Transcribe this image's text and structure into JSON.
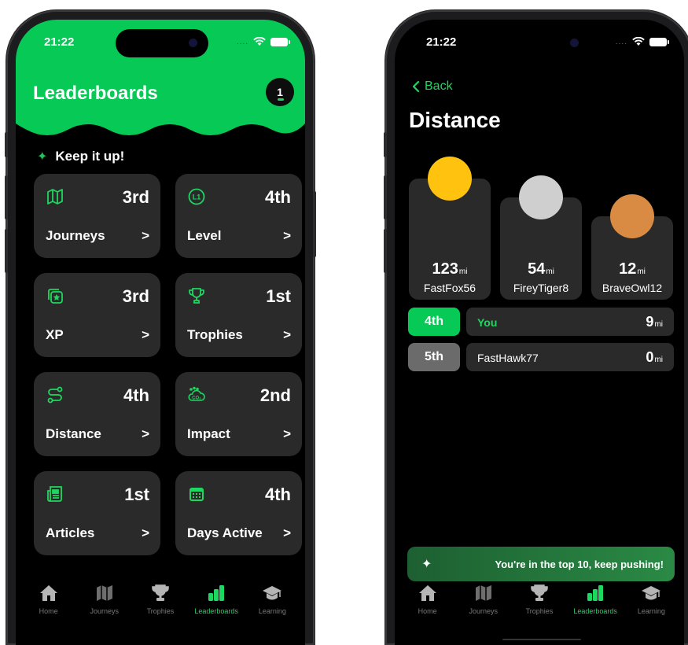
{
  "status_bar": {
    "time": "21:22",
    "signal": "...."
  },
  "leaderboards": {
    "title": "Leaderboards",
    "badge": "1",
    "encouragement": "Keep it up!",
    "cards": [
      {
        "label": "Journeys",
        "rank": "3rd",
        "icon": "map-icon"
      },
      {
        "label": "Level",
        "rank": "4th",
        "icon": "level-icon",
        "icon_text": "L1"
      },
      {
        "label": "XP",
        "rank": "3rd",
        "icon": "xp-star-icon"
      },
      {
        "label": "Trophies",
        "rank": "1st",
        "icon": "trophy-icon"
      },
      {
        "label": "Distance",
        "rank": "4th",
        "icon": "route-icon"
      },
      {
        "label": "Impact",
        "rank": "2nd",
        "icon": "co2-cloud-icon",
        "icon_text": "CO₂"
      },
      {
        "label": "Articles",
        "rank": "1st",
        "icon": "newspaper-icon"
      },
      {
        "label": "Days Active",
        "rank": "4th",
        "icon": "calendar-icon"
      }
    ],
    "chevron": ">"
  },
  "distance": {
    "back_label": "Back",
    "title": "Distance",
    "unit": "mi",
    "podium": [
      {
        "place": 1,
        "value": "123",
        "name": "FastFox56",
        "color": "#ffc20f"
      },
      {
        "place": 2,
        "value": "54",
        "name": "FireyTiger8",
        "color": "#cfcfcf"
      },
      {
        "place": 3,
        "value": "12",
        "name": "BraveOwl12",
        "color": "#d98b43"
      }
    ],
    "ranks": [
      {
        "rank": "4th",
        "name": "You",
        "value": "9",
        "highlight": true
      },
      {
        "rank": "5th",
        "name": "FastHawk77",
        "value": "0",
        "highlight": false
      }
    ],
    "toast": "You're in the top 10, keep pushing!"
  },
  "tabs": [
    {
      "label": "Home",
      "icon": "home-icon"
    },
    {
      "label": "Journeys",
      "icon": "map-icon"
    },
    {
      "label": "Trophies",
      "icon": "trophy-icon"
    },
    {
      "label": "Leaderboards",
      "icon": "leaderboard-icon",
      "active": true
    },
    {
      "label": "Learning",
      "icon": "graduation-cap-icon"
    }
  ],
  "colors": {
    "accent": "#1ed760",
    "header_green": "#07c956",
    "card": "#2a2a2a",
    "muted_chip": "#6b6b6b"
  }
}
